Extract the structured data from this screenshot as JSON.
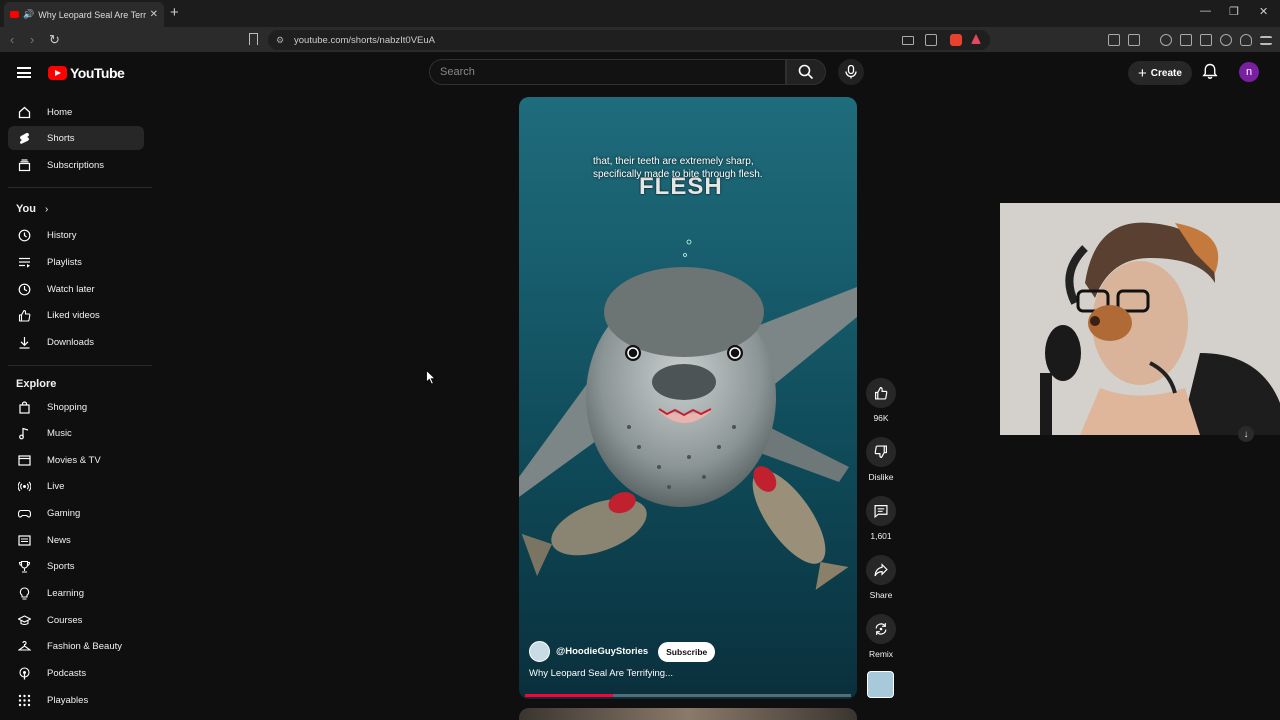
{
  "browser": {
    "tab_title": "Why Leopard Seal Are Terrify",
    "url": "youtube.com/shorts/nabzIt0VEuA"
  },
  "header": {
    "logo_text": "YouTube",
    "search_placeholder": "Search",
    "create_label": "Create",
    "avatar_letter": "n"
  },
  "sidebar": {
    "main": [
      {
        "label": "Home",
        "icon": "home-icon"
      },
      {
        "label": "Shorts",
        "icon": "shorts-icon",
        "active": true
      },
      {
        "label": "Subscriptions",
        "icon": "subscriptions-icon"
      }
    ],
    "you_heading": "You",
    "you": [
      {
        "label": "History",
        "icon": "history-icon"
      },
      {
        "label": "Playlists",
        "icon": "playlists-icon"
      },
      {
        "label": "Watch later",
        "icon": "clock-icon"
      },
      {
        "label": "Liked videos",
        "icon": "thumbs-up-icon"
      },
      {
        "label": "Downloads",
        "icon": "download-icon"
      }
    ],
    "explore_heading": "Explore",
    "explore": [
      {
        "label": "Shopping",
        "icon": "shopping-bag-icon"
      },
      {
        "label": "Music",
        "icon": "music-note-icon"
      },
      {
        "label": "Movies & TV",
        "icon": "clapperboard-icon"
      },
      {
        "label": "Live",
        "icon": "live-icon"
      },
      {
        "label": "Gaming",
        "icon": "gamepad-icon"
      },
      {
        "label": "News",
        "icon": "newspaper-icon"
      },
      {
        "label": "Sports",
        "icon": "trophy-icon"
      },
      {
        "label": "Learning",
        "icon": "lightbulb-icon"
      },
      {
        "label": "Courses",
        "icon": "graduation-cap-icon"
      },
      {
        "label": "Fashion & Beauty",
        "icon": "hanger-icon"
      },
      {
        "label": "Podcasts",
        "icon": "podcast-icon"
      },
      {
        "label": "Playables",
        "icon": "grid-dots-icon"
      }
    ]
  },
  "short": {
    "caption_line1": "that, their teeth are extremely sharp,",
    "caption_line2": "specifically made to bite through flesh.",
    "overlay_word": "FLESH",
    "channel": "@HoodieGuyStories",
    "subscribe_label": "Subscribe",
    "title": "Why Leopard Seal Are Terrifying...",
    "progress": 0.27
  },
  "actions": {
    "like_count": "96K",
    "dislike_label": "Dislike",
    "comment_count": "1,601",
    "share_label": "Share",
    "remix_label": "Remix"
  },
  "colors": {
    "accent": "#ff0033",
    "background": "#0f0f0f"
  }
}
